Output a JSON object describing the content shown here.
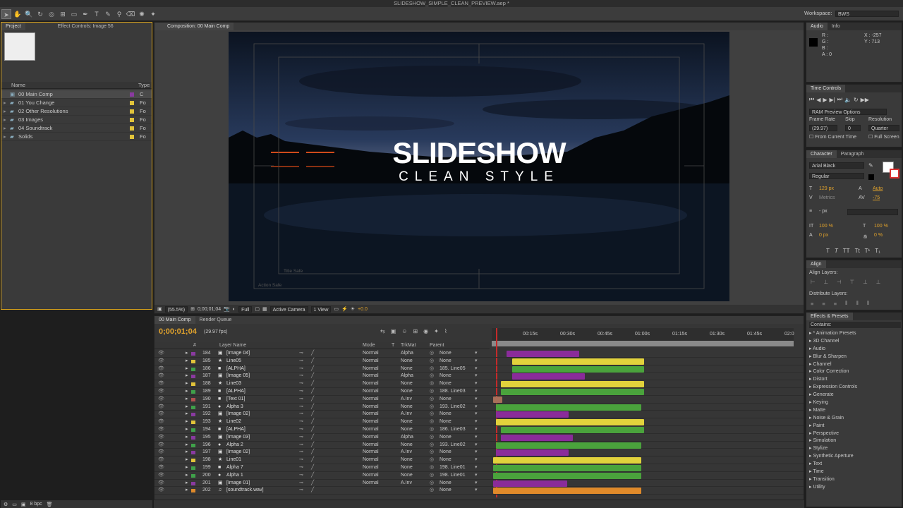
{
  "app": {
    "window_title": "SLIDESHOW_SIMPLE_CLEAN_PREVIEW.aep *",
    "workspace_label": "Workspace:",
    "workspace_value": "BWS"
  },
  "project_panel": {
    "tabs": [
      "Project",
      "Effect Controls: Image 56"
    ],
    "columns": {
      "name": "Name",
      "type": "Type"
    },
    "items": [
      {
        "name": "00 Main Comp",
        "color": "#8a3aa0",
        "type": "C"
      },
      {
        "name": "01 You Change",
        "color": "#e1c33a",
        "type": "Fo"
      },
      {
        "name": "02 Other Resolutions",
        "color": "#e1c33a",
        "type": "Fo"
      },
      {
        "name": "03 Images",
        "color": "#e1c33a",
        "type": "Fo"
      },
      {
        "name": "04 Soundtrack",
        "color": "#e1c33a",
        "type": "Fo"
      },
      {
        "name": "Solids",
        "color": "#e1c33a",
        "type": "Fo"
      }
    ],
    "bpc": "8 bpc"
  },
  "composition_panel": {
    "tab": "Composition: 00 Main Comp",
    "title_main": "SLIDESHOW",
    "title_sub": "CLEAN STYLE",
    "title_safe": "Title Safe",
    "action_safe": "Action Safe",
    "zoom": "(55.5%)",
    "timecode": "0;00;01;04",
    "resolution": "Full",
    "camera": "Active Camera",
    "view": "1 View",
    "exposure": "+0.0"
  },
  "timeline": {
    "tabs": [
      "00 Main Comp",
      "Render Queue"
    ],
    "timecode": "0;00;01;04",
    "fps": "(29.97 fps)",
    "headers": {
      "num": "#",
      "layer_name": "Layer Name",
      "mode": "Mode",
      "t": "T",
      "trkmat": "TrkMat",
      "parent": "Parent"
    },
    "ruler": [
      "00:15s",
      "00:30s",
      "00:45s",
      "01:00s",
      "01:15s",
      "01:30s",
      "01:45s",
      "02:0"
    ],
    "layers": [
      {
        "num": "184",
        "name": "[Image 04]",
        "label": "#8a3aa0",
        "kind": "img",
        "mode": "Normal",
        "trk": "Alpha",
        "parent": "None",
        "start": 0.045,
        "end": 0.29,
        "bar": "#8a2c9a"
      },
      {
        "num": "185",
        "name": "Line05",
        "label": "#e1c33a",
        "kind": "star",
        "mode": "Normal",
        "trk": "None",
        "parent": "None",
        "start": 0.065,
        "end": 0.51,
        "bar": "#e2d23c"
      },
      {
        "num": "186",
        "name": "[ALPHA]",
        "label": "#3fa14a",
        "kind": "solid",
        "mode": "Normal",
        "trk": "None",
        "parent": "185. Line05",
        "start": 0.065,
        "end": 0.51,
        "bar": "#4aa33c"
      },
      {
        "num": "187",
        "name": "[Image 05]",
        "label": "#8a3aa0",
        "kind": "img",
        "mode": "Normal",
        "trk": "Alpha",
        "parent": "None",
        "start": 0.065,
        "end": 0.31,
        "bar": "#8a2c9a"
      },
      {
        "num": "188",
        "name": "Line03",
        "label": "#e1c33a",
        "kind": "star",
        "mode": "Normal",
        "trk": "None",
        "parent": "None",
        "start": 0.025,
        "end": 0.51,
        "bar": "#e2d23c"
      },
      {
        "num": "189",
        "name": "[ALPHA]",
        "label": "#3fa14a",
        "kind": "solid",
        "mode": "Normal",
        "trk": "None",
        "parent": "188. Line03",
        "start": 0.025,
        "end": 0.51,
        "bar": "#4aa33c"
      },
      {
        "num": "190",
        "name": "[Text 01]",
        "label": "#b05050",
        "kind": "solid",
        "mode": "Normal",
        "trk": "A.Inv",
        "parent": "None",
        "start": 0.0,
        "end": 0.03,
        "bar": "#a8705a"
      },
      {
        "num": "191",
        "name": "Alpha 3",
        "label": "#3fa14a",
        "kind": "dot",
        "mode": "Normal",
        "trk": "None",
        "parent": "193. Line02",
        "start": 0.01,
        "end": 0.5,
        "bar": "#4aa33c"
      },
      {
        "num": "192",
        "name": "[Image 02]",
        "label": "#8a3aa0",
        "kind": "img",
        "mode": "Normal",
        "trk": "A.Inv",
        "parent": "None",
        "start": 0.01,
        "end": 0.255,
        "bar": "#8a2c9a"
      },
      {
        "num": "193",
        "name": "Line02",
        "label": "#e1c33a",
        "kind": "star",
        "mode": "Normal",
        "trk": "None",
        "parent": "None",
        "start": 0.01,
        "end": 0.51,
        "bar": "#e2d23c"
      },
      {
        "num": "194",
        "name": "[ALPHA]",
        "label": "#3fa14a",
        "kind": "solid",
        "mode": "Normal",
        "trk": "None",
        "parent": "186. Line03",
        "start": 0.025,
        "end": 0.51,
        "bar": "#4aa33c"
      },
      {
        "num": "195",
        "name": "[Image 03]",
        "label": "#8a3aa0",
        "kind": "img",
        "mode": "Normal",
        "trk": "Alpha",
        "parent": "None",
        "start": 0.025,
        "end": 0.27,
        "bar": "#8a2c9a"
      },
      {
        "num": "196",
        "name": "Alpha 2",
        "label": "#3fa14a",
        "kind": "dot",
        "mode": "Normal",
        "trk": "None",
        "parent": "193. Line02",
        "start": 0.01,
        "end": 0.5,
        "bar": "#4aa33c"
      },
      {
        "num": "197",
        "name": "[Image 02]",
        "label": "#8a3aa0",
        "kind": "img",
        "mode": "Normal",
        "trk": "A.Inv",
        "parent": "None",
        "start": 0.01,
        "end": 0.255,
        "bar": "#8a2c9a"
      },
      {
        "num": "198",
        "name": "Line01",
        "label": "#e1c33a",
        "kind": "star",
        "mode": "Normal",
        "trk": "None",
        "parent": "None",
        "start": 0.0,
        "end": 0.5,
        "bar": "#e2d23c"
      },
      {
        "num": "199",
        "name": "Alpha 7",
        "label": "#3fa14a",
        "kind": "solid",
        "mode": "Normal",
        "trk": "None",
        "parent": "198. Line01",
        "start": 0.0,
        "end": 0.5,
        "bar": "#4aa33c"
      },
      {
        "num": "200",
        "name": "Alpha 1",
        "label": "#3fa14a",
        "kind": "dot",
        "mode": "Normal",
        "trk": "None",
        "parent": "198. Line01",
        "start": 0.0,
        "end": 0.5,
        "bar": "#4aa33c"
      },
      {
        "num": "201",
        "name": "[Image 01]",
        "label": "#8a3aa0",
        "kind": "img",
        "mode": "Normal",
        "trk": "A.Inv",
        "parent": "None",
        "start": 0.0,
        "end": 0.25,
        "bar": "#8a2c9a"
      },
      {
        "num": "202",
        "name": "[soundtrack.wav]",
        "label": "#e08a2a",
        "kind": "audio",
        "mode": "",
        "trk": "",
        "parent": "None",
        "start": 0.0,
        "end": 0.5,
        "bar": "#e08a2a"
      }
    ]
  },
  "info_panel": {
    "tabs": [
      "Audio",
      "Info"
    ],
    "r": "R :",
    "g": "G :",
    "b": "B :",
    "a": "A : 0",
    "x": "X : -257",
    "y": "Y : 713"
  },
  "time_controls": {
    "tab": "Time Controls",
    "preview_option": "RAM Preview Options",
    "frame_rate_label": "Frame Rate",
    "skip_label": "Skip",
    "resolution_label": "Resolution",
    "frame_rate": "(29.97)",
    "skip": "0",
    "resolution": "Quarter",
    "from_current": "From Current Time",
    "full_screen": "Full Screen"
  },
  "character_panel": {
    "tabs": [
      "Character",
      "Paragraph"
    ],
    "font": "Arial Black",
    "style": "Regular",
    "size": "129 px",
    "leading": "Auto",
    "kerning": "Metrics",
    "tracking": "-75",
    "stroke": "- px",
    "vscale": "100 %",
    "hscale": "100 %",
    "baseline": "0 px",
    "tsume": "0 %"
  },
  "align_panel": {
    "tab": "Align",
    "align_layers": "Align Layers:",
    "distribute_layers": "Distribute Layers:"
  },
  "effects_panel": {
    "tab": "Effects & Presets",
    "contains": "Contains:",
    "categories": [
      "* Animation Presets",
      "3D Channel",
      "Audio",
      "Blur & Sharpen",
      "Channel",
      "Color Correction",
      "Distort",
      "Expression Controls",
      "Generate",
      "Keying",
      "Matte",
      "Noise & Grain",
      "Paint",
      "Perspective",
      "Simulation",
      "Stylize",
      "Synthetic Aperture",
      "Text",
      "Time",
      "Transition",
      "Utility"
    ]
  }
}
